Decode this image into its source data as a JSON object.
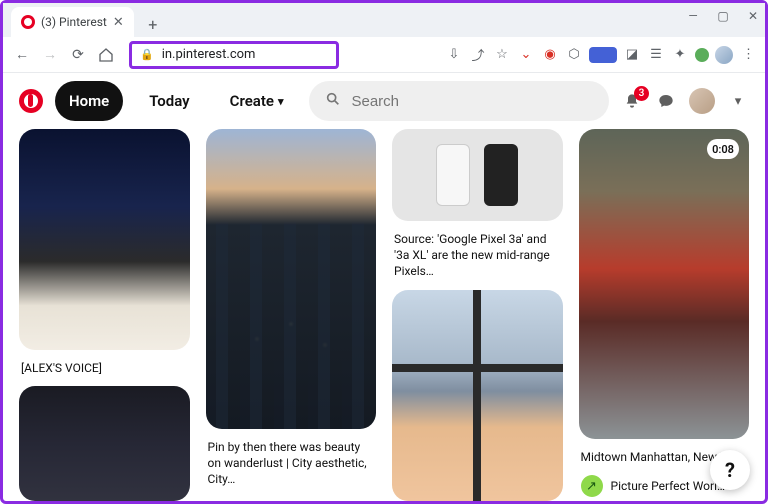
{
  "browser": {
    "tab_title": "(3) Pinterest",
    "url": "in.pinterest.com",
    "window_controls": {
      "min": "—",
      "max": "▢",
      "close": "✕"
    }
  },
  "pnav": {
    "home": "Home",
    "today": "Today",
    "create": "Create",
    "search_placeholder": "Search",
    "notification_count": "3"
  },
  "pins": {
    "a1_caption": "[ALEX'S VOICE]",
    "b1_caption": "Pin by then there was beauty on wanderlust | City aesthetic, City…",
    "c1_caption": "Source: 'Google Pixel 3a' and '3a XL' are the new mid-range Pixels…",
    "d1_caption": "Midtown Manhattan, New Yo…",
    "d1_time": "0:08",
    "d1_byline": "Picture Perfect Worl…"
  },
  "help_label": "?"
}
